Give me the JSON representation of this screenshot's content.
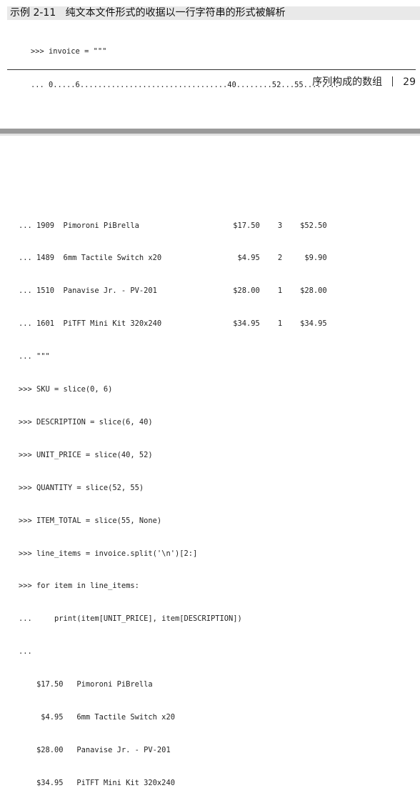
{
  "caption": "示例 2-11   纯文本文件形式的收据以一行字符串的形式被解析",
  "top_code": [
    ">>> invoice = \"\"\"",
    "... 0.....6.................................40........52...55........"
  ],
  "footer": {
    "title": "序列构成的数组",
    "page_number": "29"
  },
  "bottom_code": [
    "... 1909  Pimoroni PiBrella                     $17.50    3    $52.50",
    "... 1489  6mm Tactile Switch x20                 $4.95    2     $9.90",
    "... 1510  Panavise Jr. - PV-201                 $28.00    1    $28.00",
    "... 1601  PiTFT Mini Kit 320x240                $34.95    1    $34.95",
    "... \"\"\"",
    ">>> SKU = slice(0, 6)",
    ">>> DESCRIPTION = slice(6, 40)",
    ">>> UNIT_PRICE = slice(40, 52)",
    ">>> QUANTITY = slice(52, 55)",
    ">>> ITEM_TOTAL = slice(55, None)",
    ">>> line_items = invoice.split('\\n')[2:]",
    ">>> for item in line_items:",
    "...     print(item[UNIT_PRICE], item[DESCRIPTION])",
    "...",
    "    $17.50   Pimoroni PiBrella",
    "     $4.95   6mm Tactile Switch x20",
    "    $28.00   Panavise Jr. - PV-201",
    "    $34.95   PiTFT Mini Kit 320x240"
  ]
}
